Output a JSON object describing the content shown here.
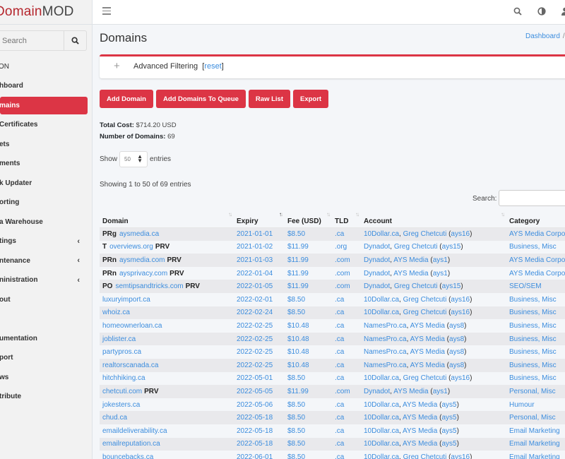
{
  "brand": {
    "part1": "Domain",
    "part2": "MOD"
  },
  "sidebar": {
    "search_placeholder": "Search",
    "header": "ON",
    "items": [
      {
        "label": "hboard",
        "active": false,
        "chevron": false
      },
      {
        "label": "mains",
        "active": true,
        "chevron": false
      },
      {
        "label": " Certificates",
        "active": false,
        "chevron": false
      },
      {
        "label": "ets",
        "active": false,
        "chevron": false
      },
      {
        "label": "ments",
        "active": false,
        "chevron": false
      },
      {
        "label": "k Updater",
        "active": false,
        "chevron": false
      },
      {
        "label": "orting",
        "active": false,
        "chevron": false
      },
      {
        "label": "a Warehouse",
        "active": false,
        "chevron": false
      },
      {
        "label": "tings",
        "active": false,
        "chevron": true
      },
      {
        "label": "ntenance",
        "active": false,
        "chevron": true
      },
      {
        "label": "ninistration",
        "active": false,
        "chevron": true
      },
      {
        "label": "out",
        "active": false,
        "chevron": false
      }
    ],
    "items2": [
      {
        "label": "umentation"
      },
      {
        "label": "port"
      },
      {
        "label": "ws"
      },
      {
        "label": "tribute"
      }
    ]
  },
  "page": {
    "title": "Domains",
    "breadcrumb": {
      "link": "Dashboard",
      "sep": "/"
    }
  },
  "filter": {
    "label": "Advanced Filtering",
    "reset_open": "[",
    "reset": "reset",
    "reset_close": "]"
  },
  "toolbar": {
    "add_domain": "Add Domain",
    "add_queue": "Add Domains To Queue",
    "raw_list": "Raw List",
    "export": "Export"
  },
  "stats": {
    "total_cost_label": "Total Cost:",
    "total_cost_value": "$714.20 USD",
    "num_domains_label": "Number of Domains:",
    "num_domains_value": "69"
  },
  "table_controls": {
    "show": "Show",
    "entries": "entries",
    "page_length": "50",
    "info": "Showing 1 to 50 of 69 entries",
    "search_label": "Search:"
  },
  "table": {
    "columns": [
      "Domain",
      "Expiry",
      "Fee (USD)",
      "TLD",
      "Account",
      "Category"
    ],
    "rows": [
      {
        "prefix": "PRg",
        "domain": "aysmedia.ca",
        "prv": "",
        "expiry": "2021-01-01",
        "fee": "$8.50",
        "tld": ".ca",
        "registrar": "10Dollar.ca",
        "owner": "Greg Chetcuti",
        "acct": "ays16",
        "category": "AYS Media Corporation"
      },
      {
        "prefix": "T",
        "domain": "overviews.org",
        "prv": "PRV",
        "expiry": "2021-01-02",
        "fee": "$11.99",
        "tld": ".org",
        "registrar": "Dynadot",
        "owner": "Greg Chetcuti",
        "acct": "ays15",
        "category": "Business, Misc"
      },
      {
        "prefix": "PRn",
        "domain": "aysmedia.com",
        "prv": "PRV",
        "expiry": "2021-01-03",
        "fee": "$11.99",
        "tld": ".com",
        "registrar": "Dynadot",
        "owner": "AYS Media",
        "acct": "ays1",
        "category": "AYS Media Corporation"
      },
      {
        "prefix": "PRn",
        "domain": "aysprivacy.com",
        "prv": "PRV",
        "expiry": "2022-01-04",
        "fee": "$11.99",
        "tld": ".com",
        "registrar": "Dynadot",
        "owner": "AYS Media",
        "acct": "ays1",
        "category": "AYS Media Corporation"
      },
      {
        "prefix": "PO",
        "domain": "semtipsandtricks.com",
        "prv": "PRV",
        "expiry": "2022-01-05",
        "fee": "$11.99",
        "tld": ".com",
        "registrar": "Dynadot",
        "owner": "Greg Chetcuti",
        "acct": "ays15",
        "category": "SEO/SEM"
      },
      {
        "prefix": "",
        "domain": "luxuryimport.ca",
        "prv": "",
        "expiry": "2022-02-01",
        "fee": "$8.50",
        "tld": ".ca",
        "registrar": "10Dollar.ca",
        "owner": "Greg Chetcuti",
        "acct": "ays16",
        "category": "Business, Misc"
      },
      {
        "prefix": "",
        "domain": "whoiz.ca",
        "prv": "",
        "expiry": "2022-02-24",
        "fee": "$8.50",
        "tld": ".ca",
        "registrar": "10Dollar.ca",
        "owner": "Greg Chetcuti",
        "acct": "ays16",
        "category": "Business, Misc"
      },
      {
        "prefix": "",
        "domain": "homeownerloan.ca",
        "prv": "",
        "expiry": "2022-02-25",
        "fee": "$10.48",
        "tld": ".ca",
        "registrar": "NamesPro.ca",
        "owner": "AYS Media",
        "acct": "ays8",
        "category": "Business, Misc"
      },
      {
        "prefix": "",
        "domain": "joblister.ca",
        "prv": "",
        "expiry": "2022-02-25",
        "fee": "$10.48",
        "tld": ".ca",
        "registrar": "NamesPro.ca",
        "owner": "AYS Media",
        "acct": "ays8",
        "category": "Business, Misc"
      },
      {
        "prefix": "",
        "domain": "partypros.ca",
        "prv": "",
        "expiry": "2022-02-25",
        "fee": "$10.48",
        "tld": ".ca",
        "registrar": "NamesPro.ca",
        "owner": "AYS Media",
        "acct": "ays8",
        "category": "Business, Misc"
      },
      {
        "prefix": "",
        "domain": "realtorscanada.ca",
        "prv": "",
        "expiry": "2022-02-25",
        "fee": "$10.48",
        "tld": ".ca",
        "registrar": "NamesPro.ca",
        "owner": "AYS Media",
        "acct": "ays8",
        "category": "Business, Misc"
      },
      {
        "prefix": "",
        "domain": "hitchhiking.ca",
        "prv": "",
        "expiry": "2022-05-01",
        "fee": "$8.50",
        "tld": ".ca",
        "registrar": "10Dollar.ca",
        "owner": "Greg Chetcuti",
        "acct": "ays16",
        "category": "Business, Misc"
      },
      {
        "prefix": "",
        "domain": "chetcuti.com",
        "prv": "PRV",
        "expiry": "2022-05-05",
        "fee": "$11.99",
        "tld": ".com",
        "registrar": "Dynadot",
        "owner": "AYS Media",
        "acct": "ays1",
        "category": "Personal, Misc"
      },
      {
        "prefix": "",
        "domain": "jokesters.ca",
        "prv": "",
        "expiry": "2022-05-06",
        "fee": "$8.50",
        "tld": ".ca",
        "registrar": "10Dollar.ca",
        "owner": "AYS Media",
        "acct": "ays5",
        "category": "Humour"
      },
      {
        "prefix": "",
        "domain": "chud.ca",
        "prv": "",
        "expiry": "2022-05-18",
        "fee": "$8.50",
        "tld": ".ca",
        "registrar": "10Dollar.ca",
        "owner": "AYS Media",
        "acct": "ays5",
        "category": "Personal, Misc"
      },
      {
        "prefix": "",
        "domain": "emaildeliverability.ca",
        "prv": "",
        "expiry": "2022-05-18",
        "fee": "$8.50",
        "tld": ".ca",
        "registrar": "10Dollar.ca",
        "owner": "AYS Media",
        "acct": "ays5",
        "category": "Email Marketing"
      },
      {
        "prefix": "",
        "domain": "emailreputation.ca",
        "prv": "",
        "expiry": "2022-05-18",
        "fee": "$8.50",
        "tld": ".ca",
        "registrar": "10Dollar.ca",
        "owner": "AYS Media",
        "acct": "ays5",
        "category": "Email Marketing"
      },
      {
        "prefix": "",
        "domain": "bouncebacks.ca",
        "prv": "",
        "expiry": "2022-06-01",
        "fee": "$8.50",
        "tld": ".ca",
        "registrar": "10Dollar.ca",
        "owner": "Greg Chetcuti",
        "acct": "ays16",
        "category": "Email Marketing"
      }
    ]
  },
  "icons": {
    "menu": "hamburger-icon",
    "search": "search-icon",
    "theme": "contrast-icon",
    "user": "user-icon"
  },
  "colors": {
    "accent": "#dc3545",
    "link": "#3c8dde",
    "brand_red": "#b5262d"
  }
}
